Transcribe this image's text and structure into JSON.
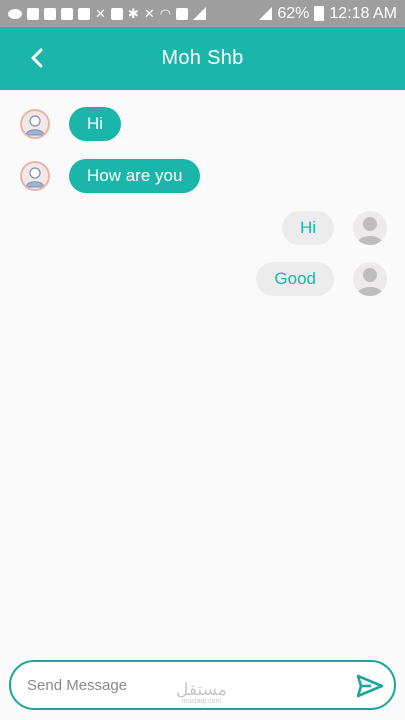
{
  "status_bar": {
    "battery": "62%",
    "time": "12:18 AM",
    "color": "#9e9e9e"
  },
  "header": {
    "title": "Moh Shb",
    "back_icon": "chevron-left-icon",
    "color": "#1cb5aa"
  },
  "messages": [
    {
      "direction": "incoming",
      "text": "Hi"
    },
    {
      "direction": "incoming",
      "text": "How are you"
    },
    {
      "direction": "outgoing",
      "text": "Hi"
    },
    {
      "direction": "outgoing",
      "text": "Good"
    }
  ],
  "composer": {
    "placeholder": "Send Message",
    "value": "",
    "send_icon": "send-icon"
  },
  "watermark": {
    "main": "مستقل",
    "sub": "mostaql.com"
  }
}
